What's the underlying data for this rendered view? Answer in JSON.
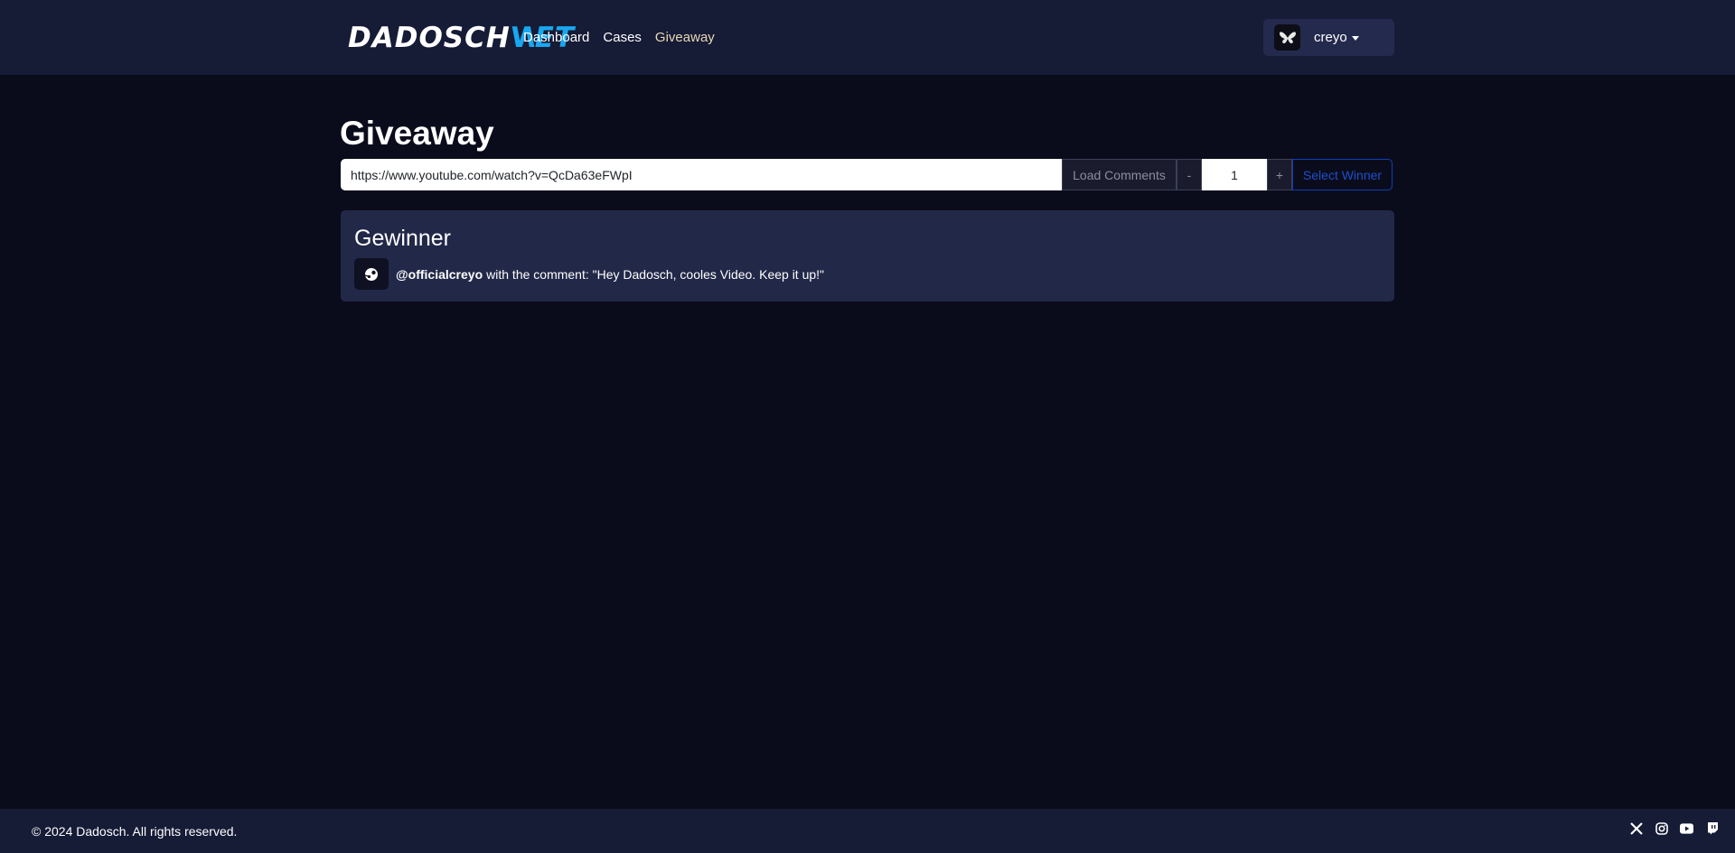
{
  "nav": {
    "logo_part1": "DADOSCH",
    "logo_part2": "NET",
    "links": [
      {
        "label": "Dashboard"
      },
      {
        "label": "Cases"
      },
      {
        "label": "Giveaway"
      }
    ],
    "user": {
      "name": "creyo"
    }
  },
  "page": {
    "title": "Giveaway"
  },
  "controls": {
    "url_value": "https://www.youtube.com/watch?v=QcDa63eFWpI",
    "load_label": "Load Comments",
    "minus_label": "-",
    "count_value": "1",
    "plus_label": "+",
    "select_label": "Select Winner"
  },
  "winner": {
    "title": "Gewinner",
    "handle": "@officialcreyo",
    "comment": "with the comment: \"Hey Dadosch, cooles Video. Keep it up!\""
  },
  "footer": {
    "copyright": "© 2024 Dadosch. All rights reserved.",
    "socials": [
      "x-icon",
      "instagram-icon",
      "youtube-icon",
      "twitch-icon"
    ]
  },
  "colors": {
    "background": "#0b0c1b",
    "navbar": "#161b36",
    "card": "#222848",
    "accent": "#19a8f0",
    "active_link": "#e9d8b4",
    "select_button": "#1c4fcc"
  }
}
